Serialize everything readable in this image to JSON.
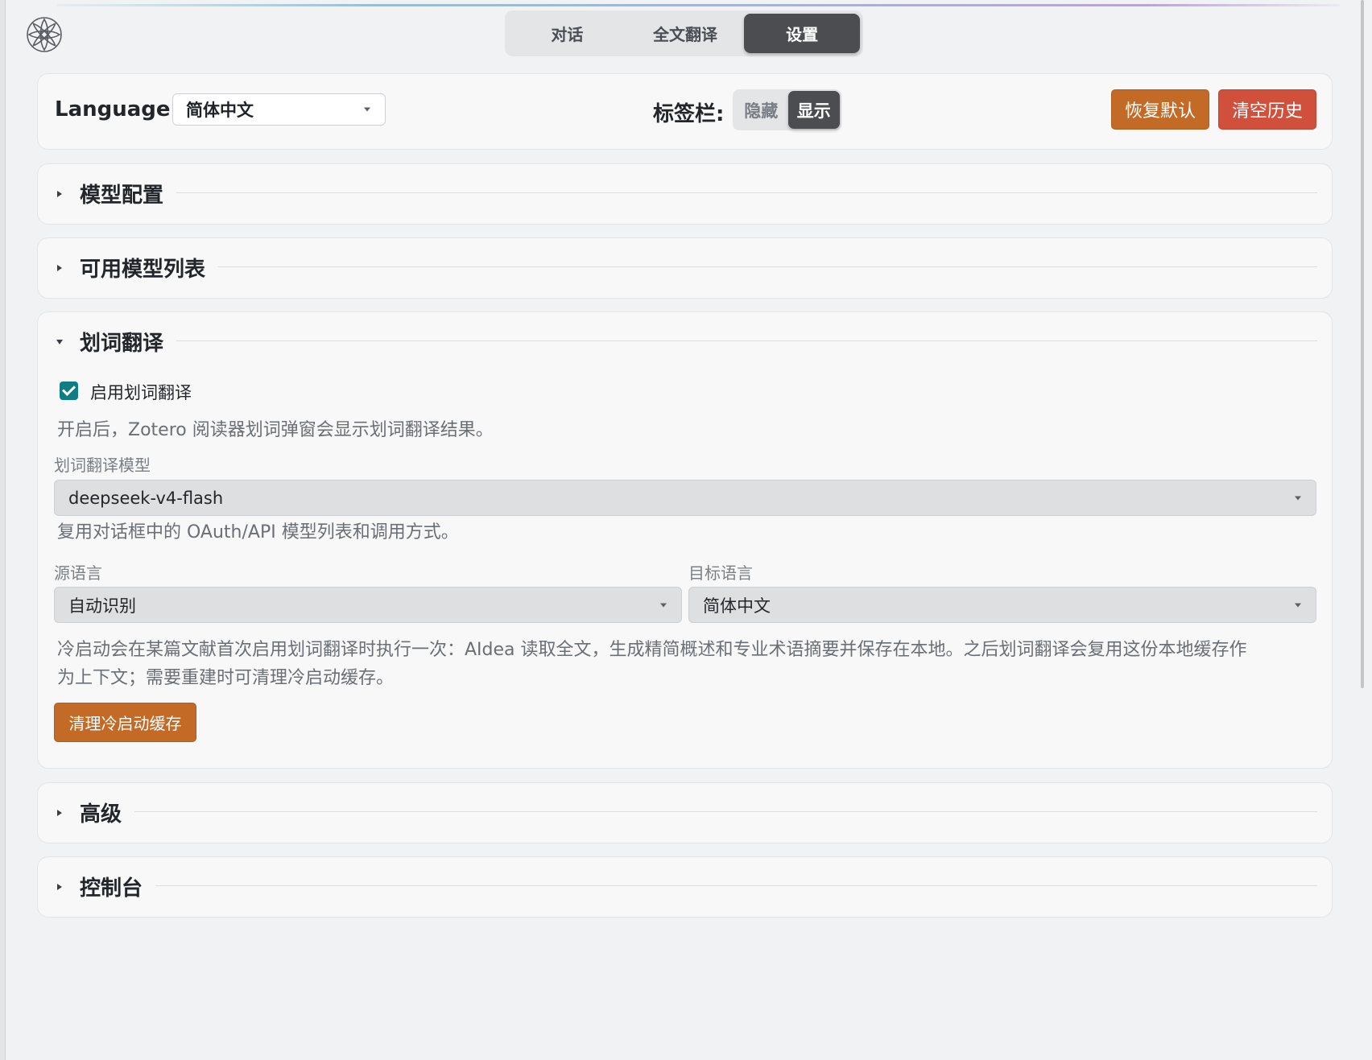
{
  "header": {
    "tabs": [
      {
        "label": "对话",
        "active": false
      },
      {
        "label": "全文翻译",
        "active": false
      },
      {
        "label": "设置",
        "active": true
      }
    ]
  },
  "topbar": {
    "language_label": "Language:",
    "language_value": "简体中文",
    "tagbar_label": "标签栏:",
    "tagbar_options": [
      "隐藏",
      "显示"
    ],
    "tagbar_selected": "显示",
    "restore_button": "恢复默认",
    "clear_history_button": "清空历史"
  },
  "sections": {
    "model_config": {
      "title": "模型配置",
      "expanded": false
    },
    "model_list": {
      "title": "可用模型列表",
      "expanded": false
    },
    "selection_translate": {
      "title": "划词翻译",
      "expanded": true,
      "enable_label": "启用划词翻译",
      "enable_checked": true,
      "enable_help": "开启后，Zotero 阅读器划词弹窗会显示划词翻译结果。",
      "model_label": "划词翻译模型",
      "model_value": "deepseek-v4-flash",
      "model_help": "复用对话框中的 OAuth/API 模型列表和调用方式。",
      "source_label": "源语言",
      "source_value": "自动识别",
      "target_label": "目标语言",
      "target_value": "简体中文",
      "cold_start_help_line1": "冷启动会在某篇文献首次启用划词翻译时执行一次：AIdea 读取全文，生成精简概述和专业术语摘要并保存在本地。之后划词翻译会复用这份本地缓存作",
      "cold_start_help_line2": "为上下文；需要重建时可清理冷启动缓存。",
      "clear_cache_button": "清理冷启动缓存"
    },
    "advanced": {
      "title": "高级",
      "expanded": false
    },
    "console": {
      "title": "控制台",
      "expanded": false
    }
  },
  "colors": {
    "accent_orange": "#c26a26",
    "danger_red": "#d1503b",
    "checkbox_teal": "#0f7d83",
    "active_tab": "#4b4d50"
  },
  "icons": [
    "app-logo-icon",
    "chevron-right-icon",
    "chevron-down-icon",
    "select-caret-icon",
    "checkmark-icon"
  ]
}
